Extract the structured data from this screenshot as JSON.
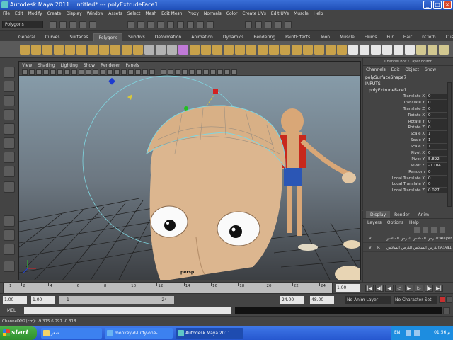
{
  "window": {
    "title": "Autodesk Maya 2011: untitled*   ---   polyExtrudeFace1..."
  },
  "menubar": [
    "File",
    "Edit",
    "Modify",
    "Create",
    "Display",
    "Window",
    "Assets",
    "Select",
    "Mesh",
    "Edit Mesh",
    "Proxy",
    "Normals",
    "Color",
    "Create UVs",
    "Edit UVs",
    "Muscle",
    "Help"
  ],
  "statusline": {
    "mode": "Polygons"
  },
  "shelf": {
    "tabs": [
      "General",
      "Curves",
      "Surfaces",
      "Polygons",
      "Subdivs",
      "Deformation",
      "Animation",
      "Dynamics",
      "Rendering",
      "PaintEffects",
      "Toon",
      "Muscle",
      "Fluids",
      "Fur",
      "Hair",
      "nCloth",
      "Custom"
    ],
    "active_tab": "Polygons"
  },
  "viewport": {
    "menu": [
      "View",
      "Shading",
      "Lighting",
      "Show",
      "Renderer",
      "Panels"
    ],
    "camera_label": "persp"
  },
  "channel_box": {
    "header": "Channel Box / Layer Editor",
    "menu": [
      "Channels",
      "Edit",
      "Object",
      "Show"
    ],
    "object_name": "polySurfaceShape7",
    "inputs_label": "INPUTS",
    "node_name": "polyExtrudeFace1",
    "attributes": [
      {
        "label": "Translate X",
        "value": "0"
      },
      {
        "label": "Translate Y",
        "value": "0"
      },
      {
        "label": "Translate Z",
        "value": "0"
      },
      {
        "label": "Rotate X",
        "value": "0"
      },
      {
        "label": "Rotate Y",
        "value": "0"
      },
      {
        "label": "Rotate Z",
        "value": "0"
      },
      {
        "label": "Scale X",
        "value": "1"
      },
      {
        "label": "Scale Y",
        "value": "1"
      },
      {
        "label": "Scale Z",
        "value": "1"
      },
      {
        "label": "Pivot X",
        "value": "0"
      },
      {
        "label": "Pivot Y",
        "value": "5.892"
      },
      {
        "label": "Pivot Z",
        "value": "-0.104"
      },
      {
        "label": "Random",
        "value": "0"
      },
      {
        "label": "Local Translate X",
        "value": "0"
      },
      {
        "label": "Local Translate Y",
        "value": "0"
      },
      {
        "label": "Local Translate Z",
        "value": "0.027"
      }
    ]
  },
  "layer_editor": {
    "tabs": [
      "Display",
      "Render",
      "Anim"
    ],
    "active_tab": "Display",
    "menu": [
      "Layers",
      "Options",
      "Help"
    ],
    "layers": [
      {
        "v": "V",
        "r": "",
        "name": "الدرس السادس الدرس السادس:Alayer"
      },
      {
        "v": "V",
        "r": "R",
        "name": "الدرس السادس الدرس السادس:A:Aa1"
      }
    ]
  },
  "time_slider": {
    "ticks": [
      "1",
      "2",
      "4",
      "6",
      "8",
      "10",
      "12",
      "14",
      "16",
      "18",
      "20",
      "22",
      "24"
    ],
    "current_frame": "1.00"
  },
  "range_slider": {
    "start": "1.00",
    "anim_start": "1.00",
    "range_start": "1",
    "range_end": "24",
    "end": "24.00",
    "anim_end": "48.00",
    "anim_layer": "No Anim Layer",
    "character_set": "No Character Set"
  },
  "command_line": {
    "label": "MEL"
  },
  "help_line": {
    "text": "ChannelXYZ(cm):    -9.375    6.297    -0.318"
  },
  "taskbar": {
    "start_label": "start",
    "items": [
      {
        "label": "شعر"
      },
      {
        "label": "monkey-d-luffy-one-..."
      },
      {
        "label": "Autodesk Maya 2011..."
      }
    ],
    "language": "EN",
    "clock": "01:56 م"
  }
}
